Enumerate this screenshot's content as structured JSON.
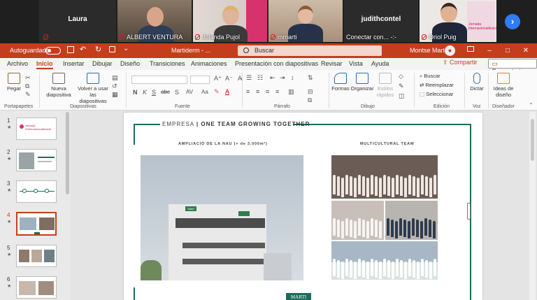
{
  "meeting": {
    "participants": [
      {
        "name": "Laura",
        "caption": ""
      },
      {
        "name": "",
        "caption": "ALBERT VENTURA"
      },
      {
        "name": "",
        "caption": "Jolanda Pujol"
      },
      {
        "name": "",
        "caption": "mmarti"
      },
      {
        "name": "judithcontel",
        "caption": "Conectar con... -:-"
      },
      {
        "name": "",
        "caption": "Oriol Puig"
      }
    ],
    "banner_text": "Jornada Internacionalització",
    "next_icon": "chevron-right"
  },
  "titlebar": {
    "autosave_label": "Autoguardado",
    "document_title": "Martiderm - ...",
    "search_placeholder": "Buscar",
    "user_name": "Montse Martí",
    "window_buttons": [
      "–",
      "□",
      "✕"
    ]
  },
  "tabs": [
    "Archivo",
    "Inicio",
    "Insertar",
    "Dibujar",
    "Diseño",
    "Transiciones",
    "Animaciones",
    "Presentación con diapositivas",
    "Revisar",
    "Vista",
    "Ayuda"
  ],
  "active_tab": "Inicio",
  "share_label": "Compartir",
  "comments_label": "Comentarios",
  "ribbon": {
    "paste": "Pegar",
    "new_slide": "Nueva diapositiva",
    "reuse": "Volver a usar las diapositivas",
    "shapes": "Formas",
    "arrange": "Organizar",
    "styles": "Estilos rápidos",
    "search": "Buscar",
    "replace": "Reemplazar",
    "select": "Seleccionar",
    "dictate": "Dictar",
    "ideas": "Ideas de diseño",
    "groups": {
      "clipboard": "Portapapeles",
      "slides": "Diapositivas",
      "font": "Fuente",
      "paragraph": "Párrafo",
      "drawing": "Dibujo",
      "editing": "Edición",
      "voice": "Voz",
      "designer": "Diseñador"
    },
    "font_format_glyphs": [
      "N",
      "K",
      "S",
      "abc",
      "S",
      "AV",
      "Aa"
    ]
  },
  "thumbnails": [
    {
      "num": "1",
      "title": "Jornada d'internacionalització"
    },
    {
      "num": "2",
      "title": ""
    },
    {
      "num": "3",
      "title": ""
    },
    {
      "num": "4",
      "title": ""
    },
    {
      "num": "5",
      "title": ""
    },
    {
      "num": "6",
      "title": ""
    }
  ],
  "selected_slide": "4",
  "slide": {
    "title_company": "EMPRESA",
    "title_rest": "| ONE TEAM GROWING TOGETHER",
    "left_subtitle": "AMPLIACIÓ DE LA NAU (+ de 3.000m²)",
    "right_subtitle": "MULTICULTURAL TEAM",
    "bottom_logo": "MARTI",
    "building_sign": "Martí"
  }
}
